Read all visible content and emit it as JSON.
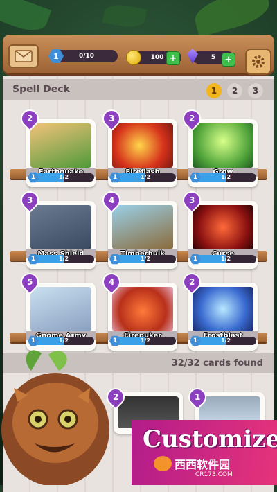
{
  "header": {
    "level": "1",
    "xp_progress": "0/10",
    "coins": "100",
    "gems": "5",
    "plus_label": "+"
  },
  "deck": {
    "title": "Spell Deck",
    "pages": [
      "1",
      "2",
      "3"
    ],
    "selected_page": "1",
    "found_text": "32/32 cards found"
  },
  "cards": [
    {
      "name": "Earthquake",
      "cost": "2",
      "level": "1",
      "progress": "1/2",
      "progress_ratio": 0.5
    },
    {
      "name": "Fireflash",
      "cost": "3",
      "level": "1",
      "progress": "1/2",
      "progress_ratio": 0.5
    },
    {
      "name": "Grow",
      "cost": "2",
      "level": "1",
      "progress": "1/2",
      "progress_ratio": 0.5
    },
    {
      "name": "Mass Shield",
      "cost": "3",
      "level": "1",
      "progress": "1/2",
      "progress_ratio": 0.5
    },
    {
      "name": "Timberhulk",
      "cost": "4",
      "level": "1",
      "progress": "1/2",
      "progress_ratio": 0.5
    },
    {
      "name": "Curse",
      "cost": "3",
      "level": "1",
      "progress": "1/2",
      "progress_ratio": 0.5
    },
    {
      "name": "Gnome Army",
      "cost": "5",
      "level": "1",
      "progress": "1/2",
      "progress_ratio": 0.5
    },
    {
      "name": "Firepuker",
      "cost": "4",
      "level": "1",
      "progress": "1/2",
      "progress_ratio": 0.5
    },
    {
      "name": "Frostblast",
      "cost": "2",
      "level": "1",
      "progress": "1/2",
      "progress_ratio": 0.5
    }
  ],
  "partial_cards": [
    {
      "cost": "2"
    },
    {
      "cost": "1"
    }
  ],
  "promo": {
    "title": "Customize",
    "watermark": "西西软件园",
    "watermark_url": "CR173.COM"
  },
  "colors": {
    "accent_blue": "#3e8fd8",
    "cost_purple": "#8c3fbf",
    "promo_pink": "#e6337a"
  }
}
